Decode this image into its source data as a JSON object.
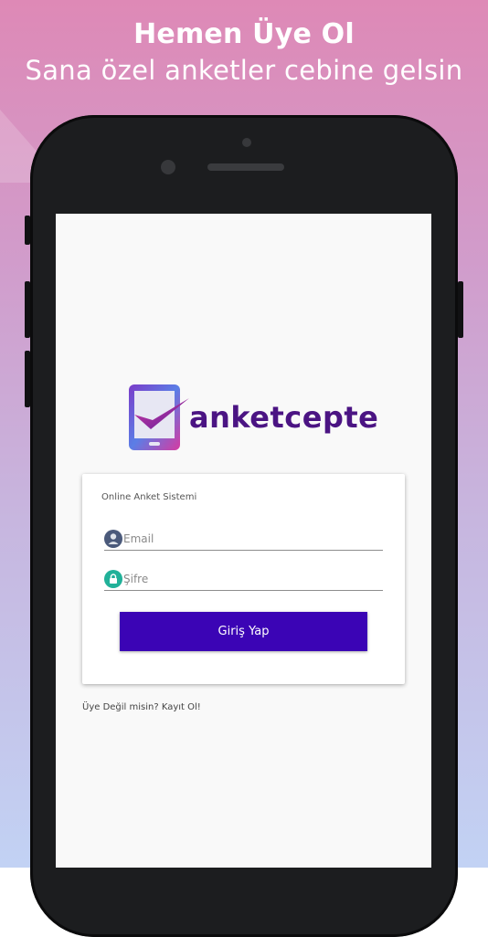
{
  "promo": {
    "headline": "Hemen Üye Ol",
    "subline": "Sana özel anketler cebine gelsin"
  },
  "logo": {
    "brand_text": "anketcepte",
    "brand_color": "#4b1483"
  },
  "login_card": {
    "title": "Online Anket Sistemi",
    "email": {
      "placeholder": "Email",
      "value": ""
    },
    "password": {
      "placeholder": "Şifre",
      "value": ""
    },
    "submit_label": "Giriş Yap",
    "accent_color": "#3b04b5"
  },
  "register_link": "Üye Değil misin? Kayıt Ol!",
  "icons": {
    "email": "user-icon",
    "password": "lock-icon"
  }
}
